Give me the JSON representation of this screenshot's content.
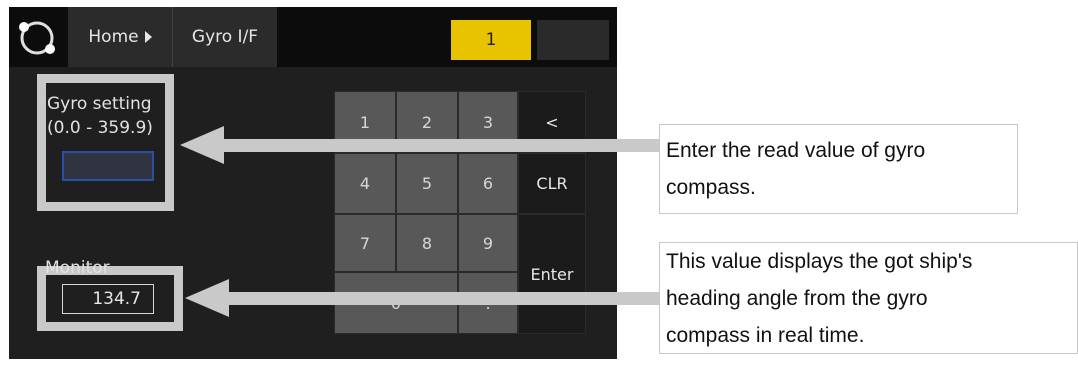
{
  "header": {
    "home_label": "Home",
    "breadcrumb_label": "Gyro I/F",
    "indicator_value": "1"
  },
  "gyro_setting": {
    "title": "Gyro setting",
    "range": "(0.0 - 359.9)",
    "value": ""
  },
  "monitor": {
    "title": "Monitor",
    "value": "134.7"
  },
  "keypad": {
    "k1": "1",
    "k2": "2",
    "k3": "3",
    "back": "<",
    "k4": "4",
    "k5": "5",
    "k6": "6",
    "clr": "CLR",
    "k7": "7",
    "k8": "8",
    "k9": "9",
    "enter": "Enter",
    "k0": "0",
    "dot": "."
  },
  "callouts": {
    "gyro_line1": "Enter the read value of gyro",
    "gyro_line2": "compass.",
    "monitor_line1": "This value displays the got ship's",
    "monitor_line2": "heading angle from the gyro",
    "monitor_line3": "compass in real time."
  },
  "colors": {
    "panel_bg": "#1f1f1f",
    "indicator_yellow": "#e8c400",
    "highlight_frame": "#c9c9c9",
    "input_border_blue": "#2b4ea8"
  }
}
